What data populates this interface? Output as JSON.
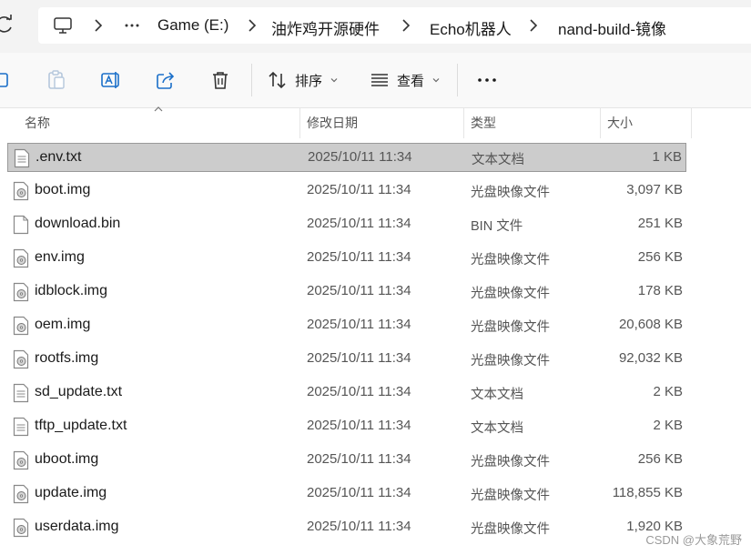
{
  "address_bar": {
    "breadcrumbs": [
      "Game (E:)",
      "油炸鸡开源硬件",
      "Echo机器人",
      "nand-build-镜像"
    ]
  },
  "toolbar": {
    "sort_label": "排序",
    "view_label": "查看"
  },
  "columns": {
    "name": "名称",
    "date": "修改日期",
    "type": "类型",
    "size": "大小"
  },
  "files": [
    {
      "name": ".env.txt",
      "date": "2025/10/11 11:34",
      "type": "文本文档",
      "size": "1 KB",
      "icon": "text-file-icon",
      "selected": true
    },
    {
      "name": "boot.img",
      "date": "2025/10/11 11:34",
      "type": "光盘映像文件",
      "size": "3,097 KB",
      "icon": "disc-image-file-icon",
      "selected": false
    },
    {
      "name": "download.bin",
      "date": "2025/10/11 11:34",
      "type": "BIN 文件",
      "size": "251 KB",
      "icon": "blank-file-icon",
      "selected": false
    },
    {
      "name": "env.img",
      "date": "2025/10/11 11:34",
      "type": "光盘映像文件",
      "size": "256 KB",
      "icon": "disc-image-file-icon",
      "selected": false
    },
    {
      "name": "idblock.img",
      "date": "2025/10/11 11:34",
      "type": "光盘映像文件",
      "size": "178 KB",
      "icon": "disc-image-file-icon",
      "selected": false
    },
    {
      "name": "oem.img",
      "date": "2025/10/11 11:34",
      "type": "光盘映像文件",
      "size": "20,608 KB",
      "icon": "disc-image-file-icon",
      "selected": false
    },
    {
      "name": "rootfs.img",
      "date": "2025/10/11 11:34",
      "type": "光盘映像文件",
      "size": "92,032 KB",
      "icon": "disc-image-file-icon",
      "selected": false
    },
    {
      "name": "sd_update.txt",
      "date": "2025/10/11 11:34",
      "type": "文本文档",
      "size": "2 KB",
      "icon": "text-file-icon",
      "selected": false
    },
    {
      "name": "tftp_update.txt",
      "date": "2025/10/11 11:34",
      "type": "文本文档",
      "size": "2 KB",
      "icon": "text-file-icon",
      "selected": false
    },
    {
      "name": "uboot.img",
      "date": "2025/10/11 11:34",
      "type": "光盘映像文件",
      "size": "256 KB",
      "icon": "disc-image-file-icon",
      "selected": false
    },
    {
      "name": "update.img",
      "date": "2025/10/11 11:34",
      "type": "光盘映像文件",
      "size": "118,855 KB",
      "icon": "disc-image-file-icon",
      "selected": false
    },
    {
      "name": "userdata.img",
      "date": "2025/10/11 11:34",
      "type": "光盘映像文件",
      "size": "1,920 KB",
      "icon": "disc-image-file-icon",
      "selected": false
    }
  ],
  "watermark": "CSDN @大象荒野",
  "colors": {
    "selection_bg": "#cccccc",
    "selection_border": "#999999",
    "toolbar_bg": "#f9f9f9",
    "address_bg": "#f3f3f3"
  }
}
